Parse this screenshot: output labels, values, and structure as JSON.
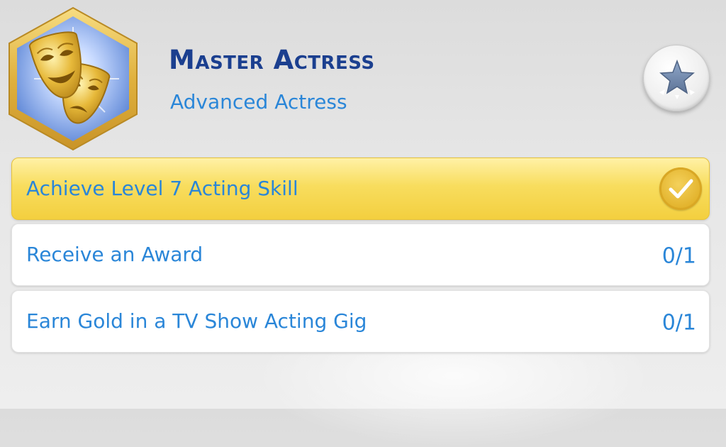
{
  "aspiration": {
    "title": "Master Actress",
    "subtitle": "Advanced Actress",
    "badge_icon": "theater-masks-icon"
  },
  "reward_button": {
    "icon": "star-icon"
  },
  "goals": [
    {
      "label": "Achieve Level 7 Acting Skill",
      "completed": true,
      "status_icon": "checkmark-icon"
    },
    {
      "label": "Receive an Award",
      "completed": false,
      "progress": "0/1"
    },
    {
      "label": "Earn Gold in a TV Show Acting Gig",
      "completed": false,
      "progress": "0/1"
    }
  ],
  "colors": {
    "title": "#1b3f8f",
    "text_blue": "#2a86d8",
    "completed_row": "#f8dd5e",
    "badge_frame": "#e8bc4a",
    "badge_background": "#7a9fe0"
  }
}
